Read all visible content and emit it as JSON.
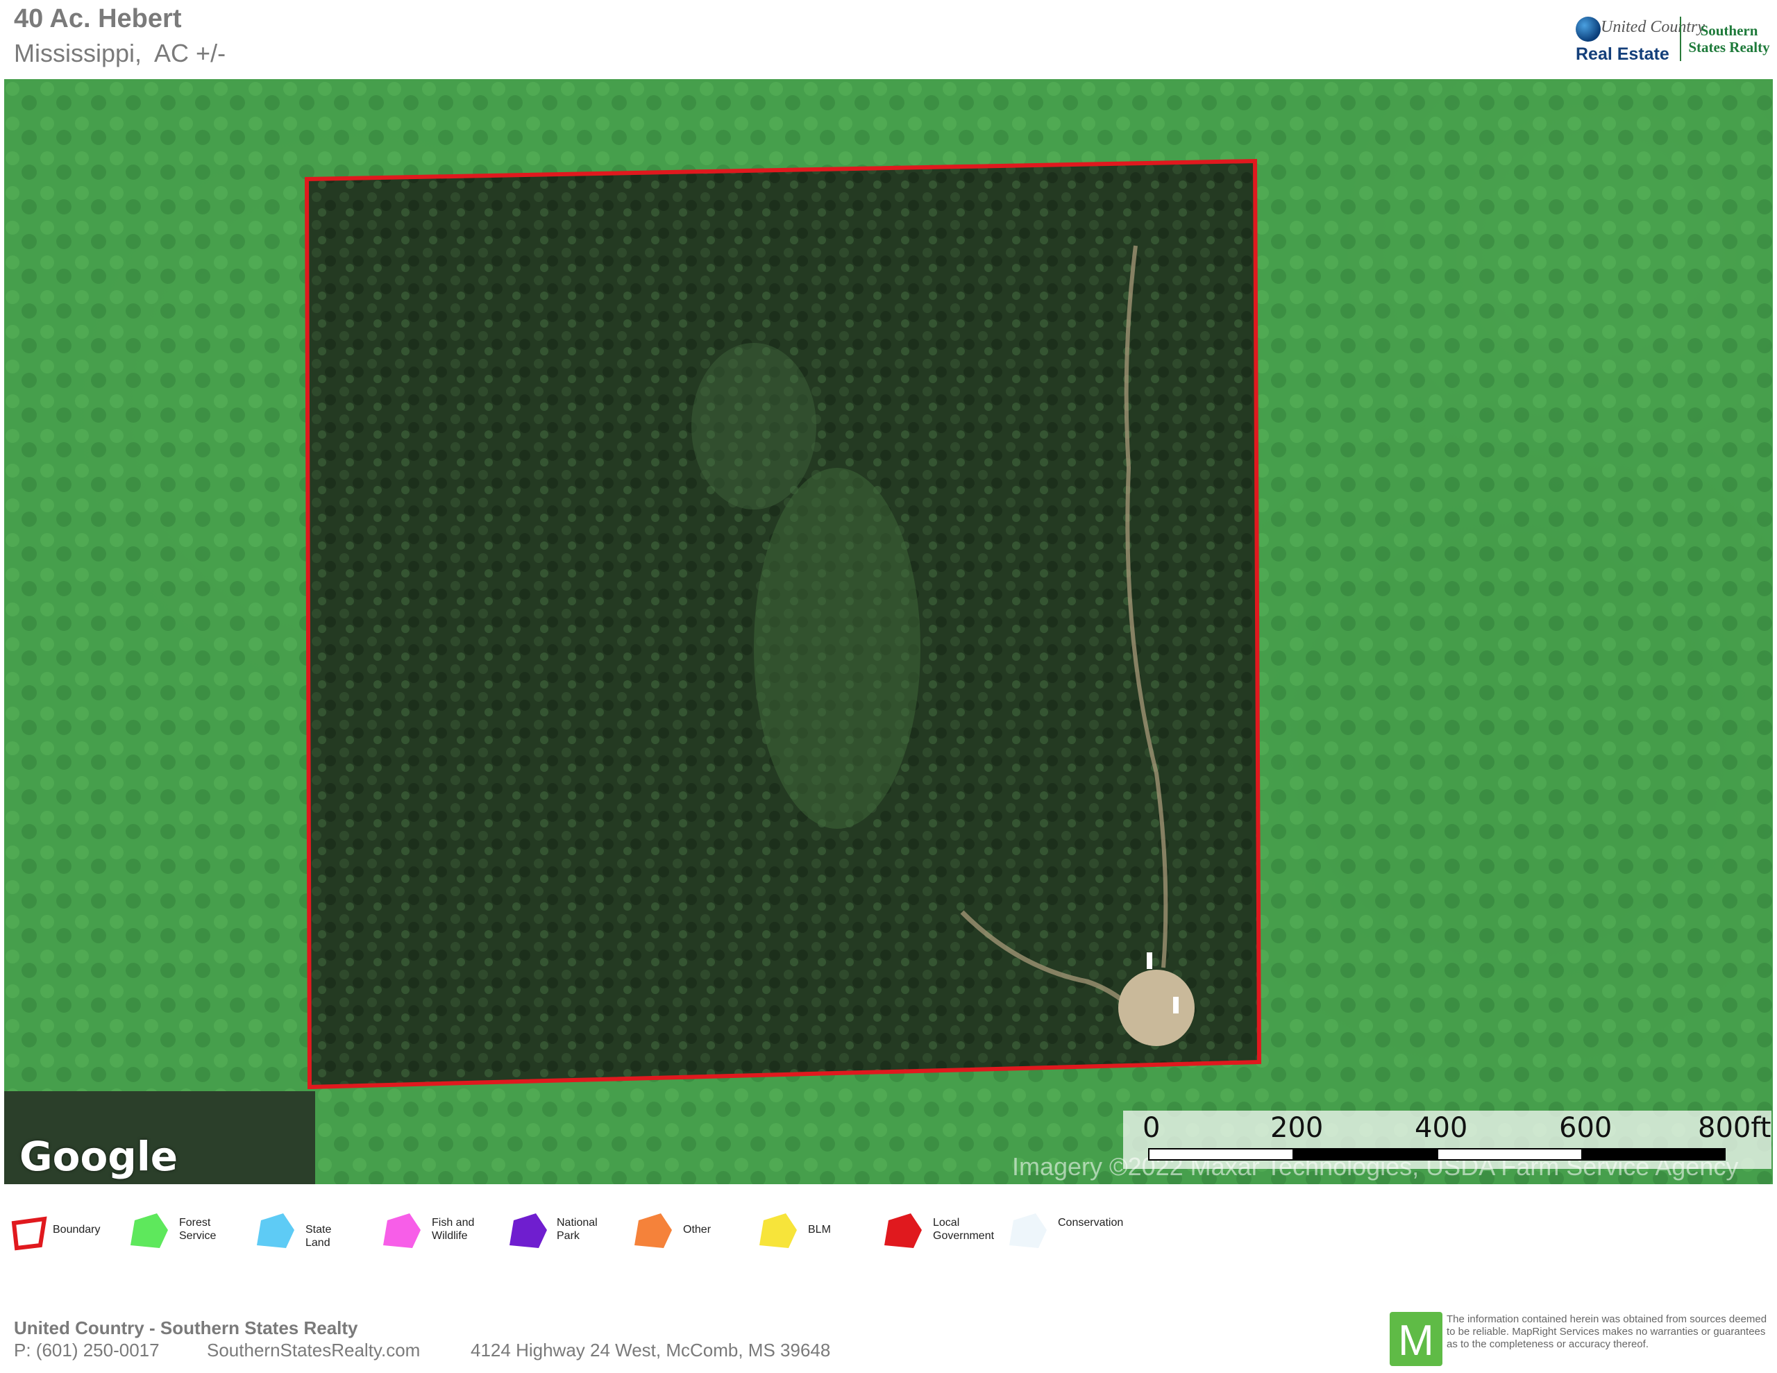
{
  "header": {
    "title": "40 Ac. Hebert",
    "subtitle": "Mississippi,  AC +/-"
  },
  "logo": {
    "line1": "United Country",
    "line2": "Real Estate",
    "partner": "Southern States Realty"
  },
  "map": {
    "provider": "Google",
    "attribution": "Imagery ©2022 Maxar Technologies, USDA Farm Service Agency",
    "boundary_color": "#e0191e",
    "scale": {
      "ticks": [
        "0",
        "200",
        "400",
        "600",
        "800ft"
      ]
    }
  },
  "legend": [
    {
      "label": "Boundary",
      "color": "#e0191e",
      "kind": "outline"
    },
    {
      "label": "Forest Service",
      "color": "#5ee85c"
    },
    {
      "label": "State Land",
      "color": "#5ecbf5"
    },
    {
      "label": "Fish and Wildlife",
      "color": "#f75ee8"
    },
    {
      "label": "National Park",
      "color": "#6f1ecf"
    },
    {
      "label": "Other",
      "color": "#f5823a"
    },
    {
      "label": "BLM",
      "color": "#f7e43a"
    },
    {
      "label": "Local Government",
      "color": "#e0191e"
    },
    {
      "label": "Conservation",
      "color": "#eef6fb"
    }
  ],
  "footer": {
    "company": "United Country - Southern States Realty",
    "phone": "P: (601) 250-0017",
    "website": "SouthernStatesRealty.com",
    "address": "4124 Highway 24 West, McComb, MS 39648",
    "disclaimer": "The information contained herein was obtained from sources deemed to be reliable. MapRight Services makes no warranties or guarantees as to the completeness or accuracy thereof.",
    "brand_letter": "M"
  }
}
